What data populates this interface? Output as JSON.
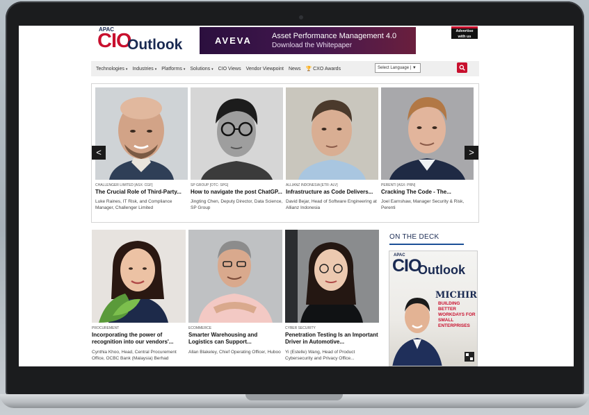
{
  "header": {
    "logo_apac": "APAC",
    "logo_cio": "CIO",
    "logo_outlook": "Outlook",
    "banner_brand": "AVEVA",
    "banner_title": "Asset Performance Management 4.0",
    "banner_subtitle": "Download the Whitepaper",
    "advertise_line1": "Advertise",
    "advertise_line2": "with us"
  },
  "nav": {
    "items": [
      {
        "label": "Technologies",
        "caret": "▾"
      },
      {
        "label": "Industries",
        "caret": "▾"
      },
      {
        "label": "Platforms",
        "caret": "▾"
      },
      {
        "label": "Solutions",
        "caret": "▾"
      },
      {
        "label": "CIO Views",
        "caret": ""
      },
      {
        "label": "Vendor Viewpoint",
        "caret": ""
      },
      {
        "label": "News",
        "caret": ""
      },
      {
        "label": "🏆 CXO Awards",
        "caret": ""
      }
    ],
    "language_select": "Select Language | ▼"
  },
  "carousel": {
    "prev": "<",
    "next": ">",
    "cards": [
      {
        "tag": "CHALLENGER LIMITED [ASX: CGF]",
        "title": "The Crucial Role of Third-Party...",
        "desc": "Luke Raines, IT Risk, and Compliance Manager, Challenger Limited"
      },
      {
        "tag": "SP GROUP [OTC: SPG]",
        "title": "How to navigate the post ChatGP...",
        "desc": "Jingting Chen, Deputy Director, Data Science, SP Group"
      },
      {
        "tag": "ALLIANZ INDONESIA [ETR: ALV]",
        "title": "Infrastructure as Code Delivers...",
        "desc": "David Bejar, Head of Software Engineering at Allianz Indonesia"
      },
      {
        "tag": "PERENTI [ASX: PRN]",
        "title": "Cracking The Code - The...",
        "desc": "Joel Earnshaw, Manager Security & Risk, Perenti"
      }
    ]
  },
  "lower": {
    "cards": [
      {
        "tag": "PROCUREMENT",
        "title": "Incorporating the power of recognition into our vendors'...",
        "desc": "Cynthia Khoo, Head, Central Procurement Office, OCBC Bank (Malaysia) Berhad"
      },
      {
        "tag": "ECOMMERCE",
        "title": "Smarter Warehousing and Logistics can Support...",
        "desc": "Allan Blakeley, Chief Operating Officer, Huboo"
      },
      {
        "tag": "CYBER SECURITY",
        "title": "Penetration Testing Is an Important Driver in Automotive...",
        "desc": "Yi (Estelle) Wang, Head of Product Cybersecurity and Privacy Office..."
      }
    ]
  },
  "deck": {
    "title": "ON THE DECK",
    "mag_apac": "APAC",
    "mag_cio": "CIO",
    "mag_outlook": "Outlook",
    "mag_company": "MICHIRU",
    "mag_headline": "BUILDING BETTER WORKDAYS FOR SMALL ENTERPRISES"
  },
  "colors": {
    "brand_red": "#c8102e",
    "brand_navy": "#1a2a52"
  }
}
